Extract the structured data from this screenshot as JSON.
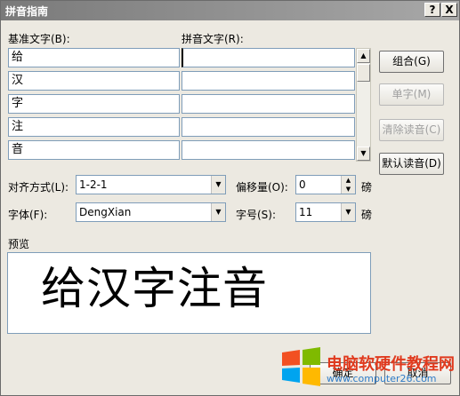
{
  "window": {
    "title": "拼音指南",
    "help_glyph": "?",
    "close_glyph": "X"
  },
  "grid": {
    "base_label": "基准文字(B):",
    "pinyin_label": "拼音文字(R):",
    "rows": [
      {
        "base": "给",
        "pinyin": ""
      },
      {
        "base": "汉",
        "pinyin": ""
      },
      {
        "base": "字",
        "pinyin": ""
      },
      {
        "base": "注",
        "pinyin": ""
      },
      {
        "base": "音",
        "pinyin": ""
      }
    ]
  },
  "buttons": {
    "combine": "组合(G)",
    "single": "单字(M)",
    "clear": "清除读音(C)",
    "default_reading": "默认读音(D)",
    "ok": "确定",
    "cancel": "取消"
  },
  "options": {
    "alignment_label": "对齐方式(L):",
    "alignment_value": "1-2-1",
    "offset_label": "偏移量(O):",
    "offset_value": "0",
    "offset_unit": "磅",
    "font_label": "字体(F):",
    "font_value": "DengXian",
    "size_label": "字号(S):",
    "size_value": "11",
    "size_unit": "磅"
  },
  "preview": {
    "label": "预览",
    "text": "给汉字注音"
  },
  "watermark": {
    "line1": "电脑软硬件教程网",
    "line2": "www.computer26.com"
  },
  "colors": {
    "accent_red": "#e03a1e",
    "accent_blue": "#2f7cc8"
  }
}
